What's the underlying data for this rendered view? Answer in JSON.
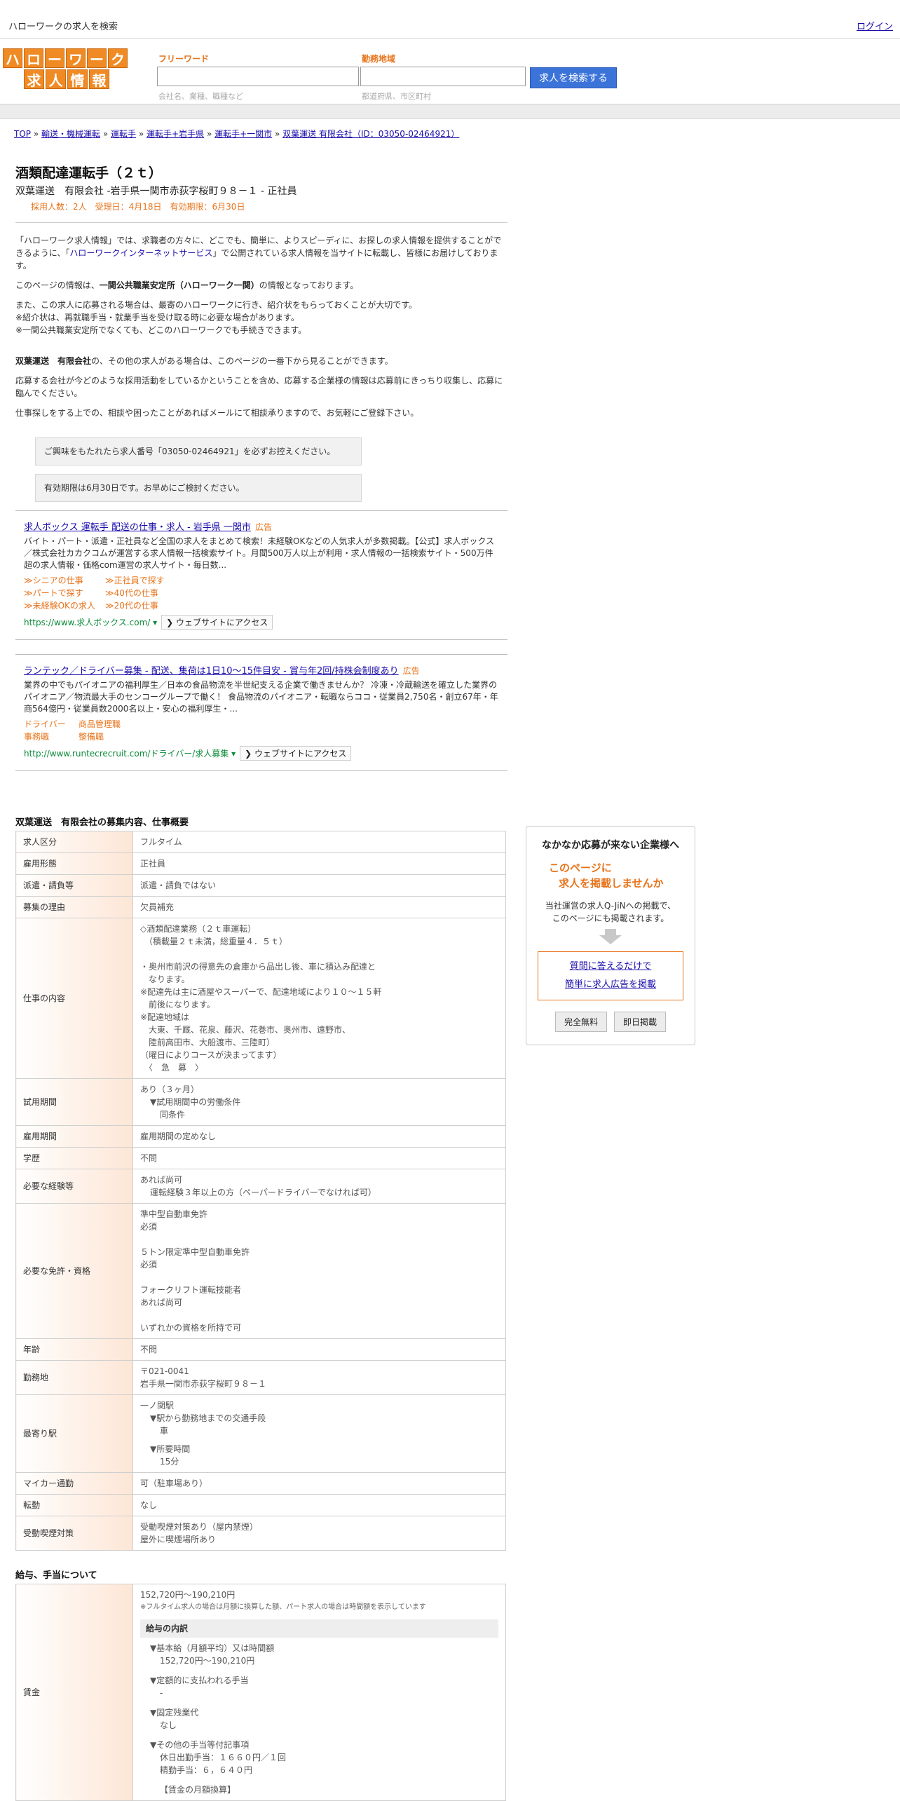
{
  "topbar": {
    "site_title": "ハローワークの求人を検索",
    "login": "ログイン"
  },
  "logo": {
    "row1": [
      "ハ",
      "ロ",
      "ー",
      "ワ",
      "ー",
      "ク"
    ],
    "row2": [
      "求",
      "人",
      "情",
      "報"
    ]
  },
  "search": {
    "keyword_label": "フリーワード",
    "keyword_placeholder": "",
    "keyword_hint": "会社名、業種、職種など",
    "area_label": "勤務地域",
    "area_placeholder": "",
    "area_hint": "都道府県、市区町村",
    "button": "求人を検索する"
  },
  "breadcrumb": {
    "items": [
      "TOP",
      "輸送・機械運転",
      "運転手",
      "運転手+岩手県",
      "運転手+一関市",
      "双葉運送 有限会社（ID：03050-02464921）"
    ],
    "sep": "»"
  },
  "job": {
    "title": "酒類配達運転手（２ｔ）",
    "company": "双葉運送　有限会社 -岩手県一関市赤荻字桜町９８－１ - 正社員",
    "meta": "採用人数：2人　受理日：4月18日　有効期限：6月30日"
  },
  "intro": {
    "p1_a": "「ハローワーク求人情報」では、求職者の方々に、どこでも、簡単に、よりスピーディに、お探しの求人情報を提供することができるように、「",
    "p1_link": "ハローワークインターネットサービス",
    "p1_b": "」で公開されている求人情報を当サイトに転載し、皆様にお届けしております。",
    "p2_a": "このページの情報は、",
    "p2_b": "一関公共職業安定所（ハローワーク一関）",
    "p2_c": "の情報となっております。",
    "p3_1": "また、この求人に応募される場合は、最寄のハローワークに行き、紹介状をもらっておくことが大切です。",
    "p3_2": "※紹介状は、再就職手当・就業手当を受け取る時に必要な場合があります。",
    "p3_3": "※一関公共職業安定所でなくても、どこのハローワークでも手続きできます。",
    "p4_a": "双葉運送　有限会社",
    "p4_b": "の、その他の求人がある場合は、このページの一番下から見ることができます。",
    "p5": "応募する会社が今どのような採用活動をしているかということを含め、応募する企業様の情報は応募前にきっちり収集し、応募に臨んでください。",
    "p6": "仕事探しをする上での、相談や困ったことがあればメールにて相談承りますので、お気軽にご登録下さい。"
  },
  "notices": {
    "n1": "ご興味をもたれたら求人番号「03050-02464921」を必ずお控えください。",
    "n2": "有効期限は6月30日です。お早めにご検討ください。"
  },
  "ads": [
    {
      "title": "求人ボックス 運転手 配送の仕事・求人 - 岩手県 一関市",
      "badge": "広告",
      "desc": "バイト・パート・派遣・正社員など全国の求人をまとめて検索！未経験OKなどの人気求人が多数掲載。【公式】求人ボックス／株式会社カカクコムが運営する求人情報一括検索サイト。月間500万人以上が利用・求人情報の一括検索サイト・500万件超の求人情報・価格com運営の求人サイト・毎日数...",
      "links": [
        "≫シニアの仕事",
        "≫正社員で探す",
        "≫パートで探す",
        "≫40代の仕事",
        "≫未経験OKの求人",
        "≫20代の仕事"
      ],
      "url": "https://www.求人ボックス.com/ ▾",
      "visit": "❯ ウェブサイトにアクセス"
    },
    {
      "title": "ランテック／ドライバー募集 - 配送、集荷は1日10～15件目安 - 賞与年2回/持株会制度あり",
      "badge": "広告",
      "desc": "業界の中でもパイオニアの福利厚生／日本の食品物流を半世紀支える企業で働きませんか？ 冷凍・冷蔵輸送を確立した業界のパイオニア／物流最大手のセンコーグループで働く！ 食品物流のパイオニア・転職ならココ・従業員2,750名・創立67年・年商564億円・従業員数2000名以上・安心の福利厚生・...",
      "links": [
        "ドライバー",
        "商品管理職",
        "事務職",
        "整備職"
      ],
      "url": "http://www.runtecrecruit.com/ドライバー/求人募集 ▾",
      "visit": "❯ ウェブサイトにアクセス"
    }
  ],
  "details": {
    "title": "双葉運送　有限会社の募集内容、仕事概要",
    "rows": {
      "kubun": {
        "k": "求人区分",
        "v": "フルタイム"
      },
      "keitai": {
        "k": "雇用形態",
        "v": "正社員"
      },
      "haken": {
        "k": "派遣・請負等",
        "v": "派遣・請負ではない"
      },
      "riyu": {
        "k": "募集の理由",
        "v": "欠員補充"
      },
      "naiyo": {
        "k": "仕事の内容",
        "lines": [
          "◇酒類配達業務（２ｔ車運転）",
          "　（積載量２ｔ未満，総重量４．５ｔ）",
          "",
          "・奥州市前沢の得意先の倉庫から品出し後、車に積込み配達と",
          "　なります。",
          "※配達先は主に酒屋やスーパーで、配達地域により１０～１５軒",
          "　前後になります。",
          "※配達地域は",
          "　大東、千厩、花泉、藤沢、花巻市、奥州市、遠野市、",
          "　陸前高田市、大船渡市、三陸町）",
          "（曜日によりコースが決まってます）",
          "　〈　急　募　〉"
        ]
      },
      "shiyo": {
        "k": "試用期間",
        "v1": "あり（３ヶ月）",
        "v2": "▼試用期間中の労働条件",
        "v3": "同条件"
      },
      "koyo": {
        "k": "雇用期間",
        "v": "雇用期間の定めなし"
      },
      "gakureki": {
        "k": "学歴",
        "v": "不問"
      },
      "keiken": {
        "k": "必要な経験等",
        "v1": "あれば尚可",
        "v2": "運転経験３年以上の方（ペーパードライバーでなければ可）"
      },
      "menkyo": {
        "k": "必要な免許・資格",
        "lines": [
          "準中型自動車免許",
          "必須",
          "",
          "５トン限定準中型自動車免許",
          "必須",
          "",
          "フォークリフト運転技能者",
          "あれば尚可",
          "",
          "いずれかの資格を所持で可"
        ]
      },
      "nenrei": {
        "k": "年齢",
        "v": "不問"
      },
      "kinmuchi": {
        "k": "勤務地",
        "v1": "〒021-0041",
        "v2": "岩手県一関市赤荻字桜町９８－１"
      },
      "eki": {
        "k": "最寄り駅",
        "v1": "一ノ関駅",
        "v2": "▼駅から勤務地までの交通手段",
        "v3": "車",
        "v4": "▼所要時間",
        "v5": "15分"
      },
      "mycar": {
        "k": "マイカー通勤",
        "v": "可（駐車場あり）"
      },
      "tenkin": {
        "k": "転勤",
        "v": "なし"
      },
      "kitsuen": {
        "k": "受動喫煙対策",
        "v1": "受動喫煙対策あり（屋内禁煙）",
        "v2": "屋外に喫煙場所あり"
      }
    }
  },
  "salary": {
    "title": "給与、手当について",
    "k": "賃金",
    "range": "152,720円〜190,210円",
    "note": "※フルタイム求人の場合は月額に換算した額、パート求人の場合は時間額を表示しています",
    "box": "給与の内訳",
    "l1": "▼基本給（月額平均）又は時間額",
    "l2": "152,720円〜190,210円",
    "l3": "▼定額的に支払われる手当",
    "l4": "-",
    "l5": "▼固定残業代",
    "l6": "なし",
    "l7": "▼その他の手当等付記事項",
    "l8": "休日出勤手当：１６６０円／１回",
    "l9": "精勤手当：６，６４０円",
    "l10": "【賃金の月額換算】"
  },
  "side": {
    "title": "なかなか応募が来ない企業様へ",
    "orange1": "このページに",
    "orange2": "求人を掲載しませんか",
    "text1": "当社運営の求人Q-JiNへの掲載で、",
    "text2": "このページにも掲載されます。",
    "link1": "質問に答えるだけで",
    "link2": "簡単に求人広告を掲載",
    "btn1": "完全無料",
    "btn2": "即日掲載"
  }
}
